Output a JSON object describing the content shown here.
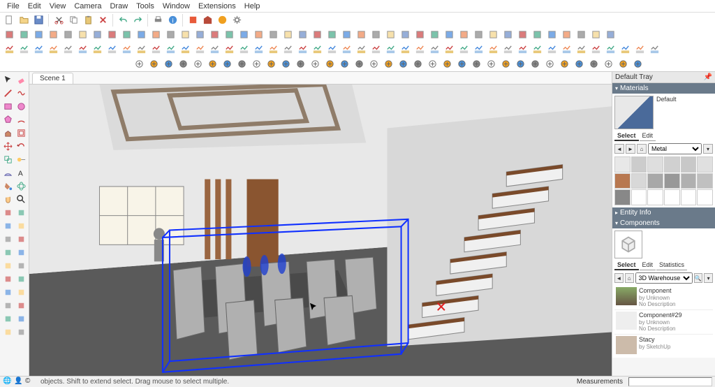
{
  "menu": [
    "File",
    "Edit",
    "View",
    "Camera",
    "Draw",
    "Tools",
    "Window",
    "Extensions",
    "Help"
  ],
  "scene_tab": "Scene 1",
  "tray": {
    "title": "Default Tray",
    "materials": {
      "header": "Materials",
      "preview_label": "Default",
      "tabs": [
        "Select",
        "Edit"
      ],
      "active_tab": "Select",
      "category": "Metal",
      "swatches": [
        "#e8e8e8",
        "#cccccc",
        "#dedede",
        "#d0d0d0",
        "#c8c8c8",
        "#e0e0e0",
        "#b87850",
        "#d8d8d8",
        "#a8a8a8",
        "#989898",
        "#b0b0b0",
        "#c0c0c0",
        "#888888",
        "#ffffff",
        "#ffffff",
        "#ffffff",
        "#ffffff",
        "#ffffff"
      ]
    },
    "entity_info": {
      "header": "Entity Info"
    },
    "components": {
      "header": "Components",
      "tabs": [
        "Select",
        "Edit",
        "Statistics"
      ],
      "active_tab": "Select",
      "source": "3D Warehouse",
      "items": [
        {
          "title": "Component",
          "by": "by Unknown",
          "desc": "No Description"
        },
        {
          "title": "Component#29",
          "by": "by Unknown",
          "desc": "No Description"
        },
        {
          "title": "Stacy",
          "by": "by SketchUp",
          "desc": ""
        }
      ]
    }
  },
  "status": {
    "hint": "objects. Shift to extend select. Drag mouse to select multiple.",
    "meas_label": "Measurements"
  }
}
